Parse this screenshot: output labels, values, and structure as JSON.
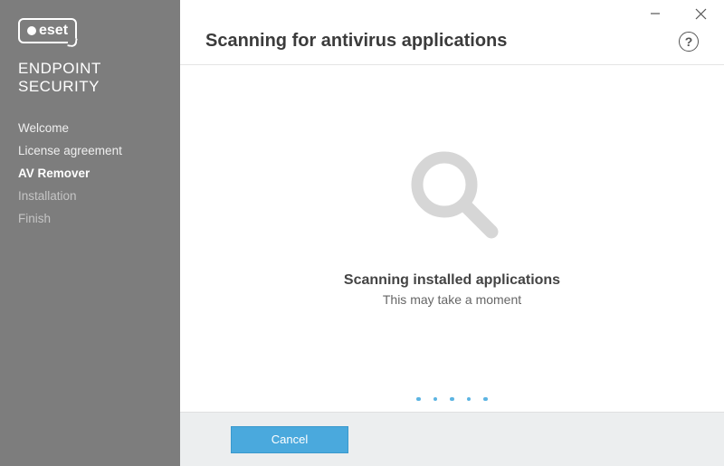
{
  "brand": {
    "logo_text": "eset",
    "product_line1": "ENDPOINT",
    "product_line2": "SECURITY"
  },
  "sidebar": {
    "items": [
      {
        "label": "Welcome",
        "state": "done"
      },
      {
        "label": "License agreement",
        "state": "done"
      },
      {
        "label": "AV Remover",
        "state": "active"
      },
      {
        "label": "Installation",
        "state": "pending"
      },
      {
        "label": "Finish",
        "state": "pending"
      }
    ]
  },
  "header": {
    "title": "Scanning for antivirus applications"
  },
  "content": {
    "status_title": "Scanning installed applications",
    "status_subtitle": "This may take a moment"
  },
  "footer": {
    "cancel_label": "Cancel"
  }
}
